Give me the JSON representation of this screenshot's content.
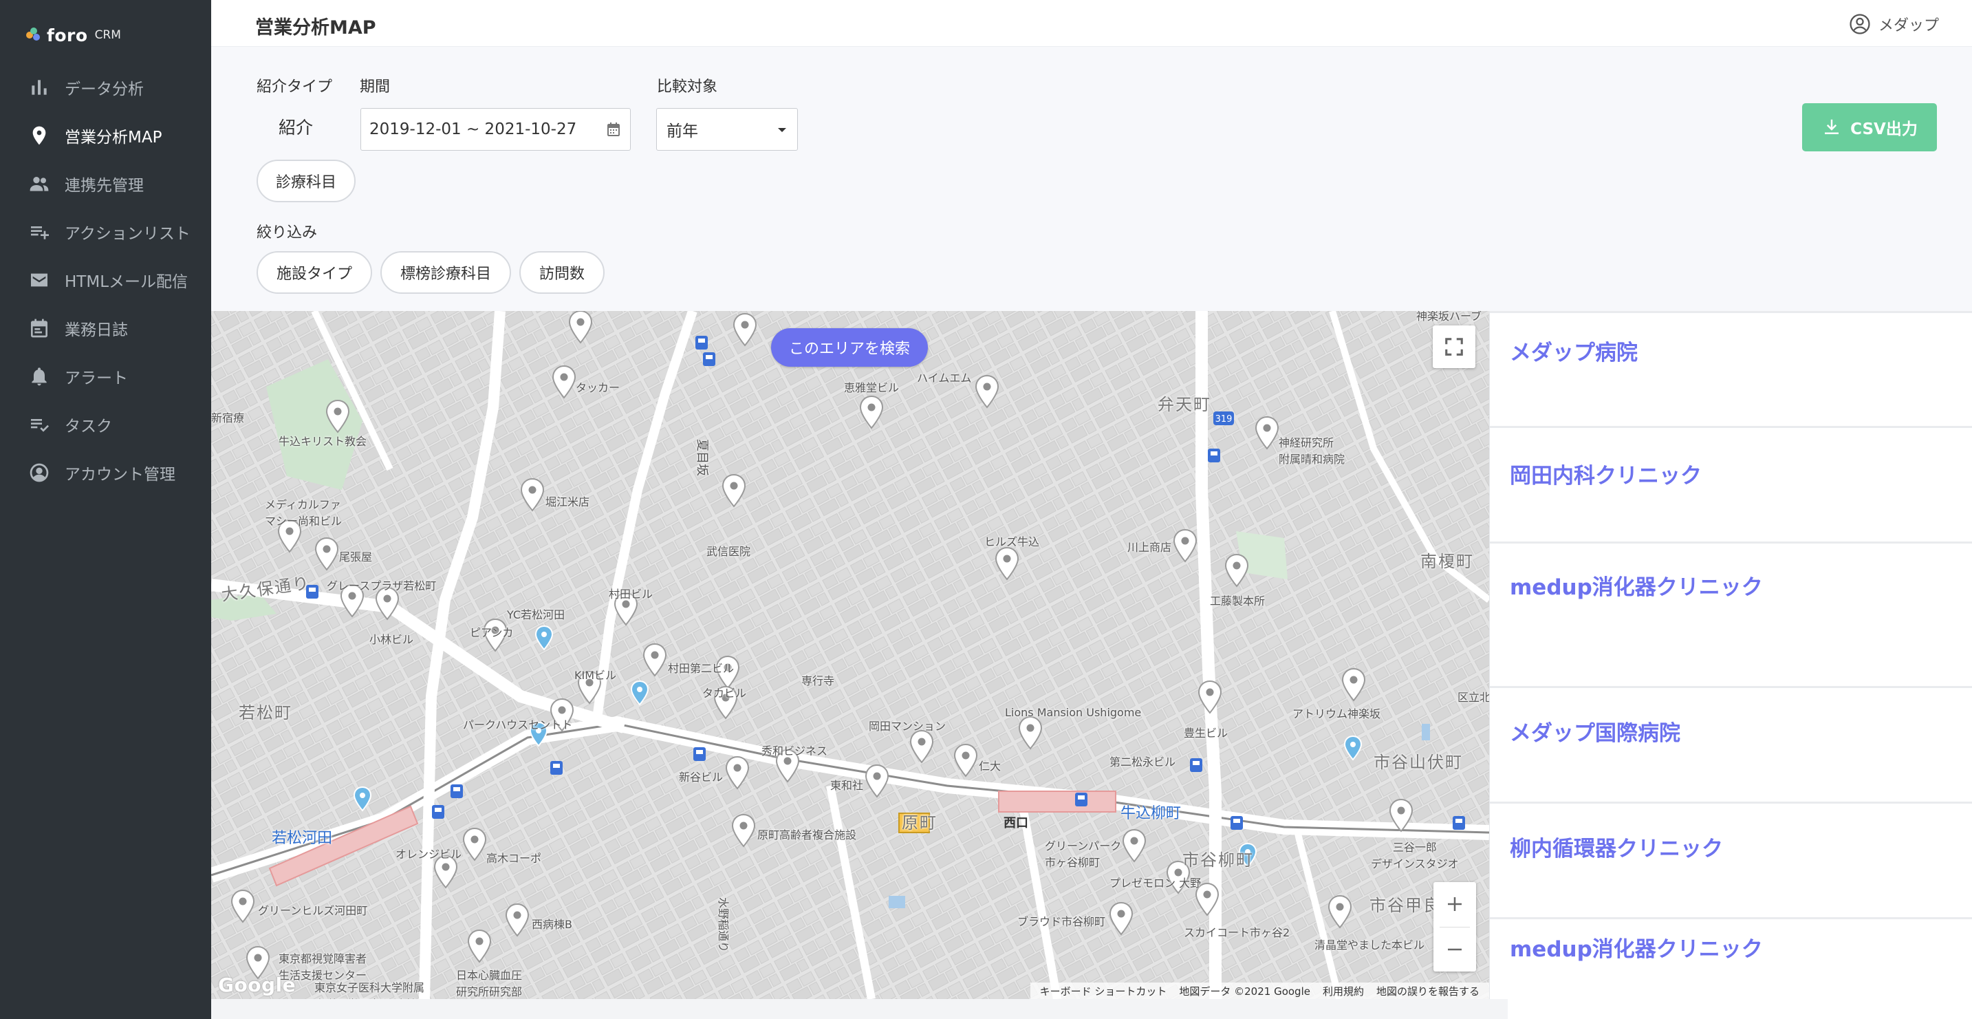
{
  "app": {
    "logo_text": "foro",
    "logo_sub": "CRM"
  },
  "sidebar": {
    "items": [
      {
        "label": "データ分析",
        "icon": "bar-chart-icon",
        "active": false
      },
      {
        "label": "営業分析MAP",
        "icon": "map-pin-icon",
        "active": true
      },
      {
        "label": "連携先管理",
        "icon": "people-icon",
        "active": false
      },
      {
        "label": "アクションリスト",
        "icon": "playlist-add-icon",
        "active": false
      },
      {
        "label": "HTMLメール配信",
        "icon": "mail-icon",
        "active": false
      },
      {
        "label": "業務日誌",
        "icon": "calendar-icon",
        "active": false
      },
      {
        "label": "アラート",
        "icon": "bell-icon",
        "active": false
      },
      {
        "label": "タスク",
        "icon": "checklist-icon",
        "active": false
      },
      {
        "label": "アカウント管理",
        "icon": "account-icon",
        "active": false
      }
    ]
  },
  "header": {
    "title": "営業分析MAP",
    "user_name": "メダップ"
  },
  "filters": {
    "type_label": "紹介タイプ",
    "type_value": "紹介",
    "period_label": "期間",
    "period_value": "2019-12-01 ~ 2021-10-27",
    "compare_label": "比較対象",
    "compare_value": "前年",
    "dept_chip": "診療科目",
    "narrow_label": "絞り込み",
    "chips": [
      "施設タイプ",
      "標榜診療科目",
      "訪問数"
    ],
    "csv_label": "CSV出力"
  },
  "map": {
    "search_area_label": "このエリアを検索",
    "labels": {
      "tacker": "タッカー",
      "ushigome_church": "牛込キリスト教会",
      "medical": "メディカルファ\nマシー尚和ビル",
      "horie": "堀江米店",
      "natsume": "夏目坂",
      "takeda": "武信医院",
      "keigado": "恵雅堂ビル",
      "haimu": "ハイムエム",
      "bentencho": "弁天町",
      "kobe": "神経研究所\n附属晴和病院",
      "hills": "ヒルズ牛込",
      "kawakami": "川上商店",
      "kudo": "工藤製本所",
      "minami": "南榎町",
      "okubo": "大久保通り",
      "obari": "尾張屋",
      "grace": "グレースプラザ若松町",
      "kobayashi": "小林ビル",
      "yc": "YC若松河田",
      "murata": "村田ビル",
      "pianka": "ピアンカ",
      "kim": "KIMビル",
      "murata2": "村田第二ビル",
      "senko": "専行寺",
      "takabiru": "タカビル",
      "wakamatsu": "若松町",
      "park": "パークハウスセントト",
      "okada": "岡田マンション",
      "lions": "Lions Mansion Ushigome",
      "atrium": "アトリウム神楽坂",
      "ichigaya": "市谷山伏町",
      "shuwa": "秀和ビジネス",
      "shinko": "新谷ビル",
      "towa": "東和社",
      "jindai": "仁大",
      "daini": "第二松永ビル",
      "toyo": "豊生ビル",
      "wakamatsu_station": "若松河田",
      "ushigome_station": "牛込柳町",
      "nishiguchi": "西口",
      "haramachi": "原町",
      "harada": "原町高齢者複合施設",
      "ichigaya_yanagi": "市谷柳町",
      "green_park": "グリーンパーク\n市ヶ谷柳町",
      "olive": "オレンジビル",
      "takagi": "高木コーポ",
      "presemon": "プレゼモロン 大野",
      "sanya": "三谷一郎\nデザインスタジオ",
      "ichigaya_kora": "市谷甲良",
      "green_hills": "グリーンヒルズ河田町",
      "nishibyo": "西病棟B",
      "tokyo_visual": "東京都視覚障害者\n生活支援センター",
      "tokyo_women": "東京女子医科大学附属\n東洋医学研究所 病棟",
      "nihon": "日本心臓血圧\n研究所研究部",
      "mizuno": "水野稲通り",
      "broad": "ブラウド市谷柳町",
      "skycourt": "スカイコート市ヶ谷2",
      "kiyoharado": "清晶堂やました本ビル",
      "kuritsu": "区立北",
      "shinryo": "新宿療",
      "kakejuku": "神楽坂ハーブ"
    },
    "footer": [
      "キーボード ショートカット",
      "地図データ ©2021 Google",
      "利用規約",
      "地図の誤りを報告する"
    ],
    "google_logo": "Google"
  },
  "list": {
    "items": [
      "メダップ病院",
      "岡田内科クリニック",
      "medup消化器クリニック",
      "メダップ国際病院",
      "柳内循環器クリニック",
      "medup消化器クリニック"
    ]
  }
}
